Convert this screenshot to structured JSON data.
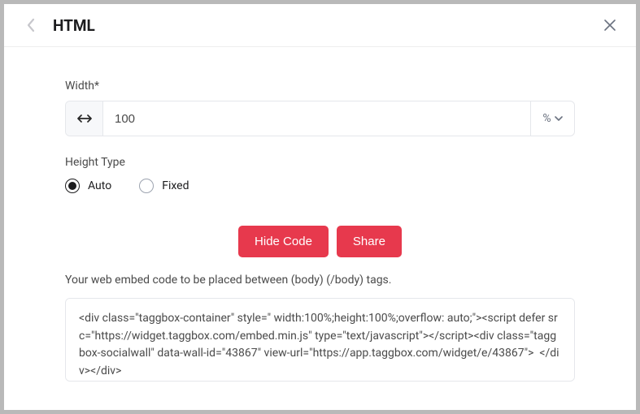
{
  "header": {
    "title": "HTML"
  },
  "width_section": {
    "label": "Width*",
    "value": "100",
    "unit": "%"
  },
  "height_type": {
    "label": "Height Type",
    "options": [
      {
        "label": "Auto",
        "selected": true
      },
      {
        "label": "Fixed",
        "selected": false
      }
    ]
  },
  "buttons": {
    "hide_code": "Hide Code",
    "share": "Share"
  },
  "embed": {
    "helper": "Your web embed code to be placed between (body) (/body) tags.",
    "code": "<div class=\"taggbox-container\" style=\" width:100%;height:100%;overflow: auto;\"><script defer src=\"https://widget.taggbox.com/embed.min.js\" type=\"text/javascript\"></script><div class=\"taggbox-socialwall\" data-wall-id=\"43867\" view-url=\"https://app.taggbox.com/widget/e/43867\">  </div></div>"
  }
}
